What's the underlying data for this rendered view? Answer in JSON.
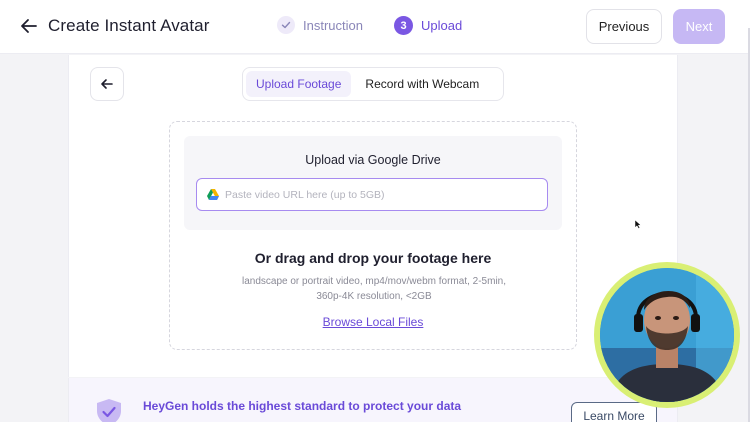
{
  "header": {
    "title": "Create Instant Avatar",
    "steps": [
      {
        "label": "Instruction",
        "state": "done"
      },
      {
        "number": "3",
        "label": "Upload",
        "state": "active"
      }
    ],
    "previous_label": "Previous",
    "next_label": "Next"
  },
  "tabs": [
    {
      "label": "Upload Footage",
      "active": true
    },
    {
      "label": "Record with Webcam",
      "active": false
    }
  ],
  "upload": {
    "drive_title": "Upload via Google Drive",
    "url_placeholder": "Paste video URL here (up to 5GB)",
    "drag_title": "Or drag and drop your footage here",
    "drag_desc_line1": "landscape or portrait video, mp4/mov/webm format, 2-5min,",
    "drag_desc_line2": "360p-4K resolution, <2GB",
    "browse_label": "Browse Local Files"
  },
  "banner": {
    "text": "HeyGen holds the highest standard to protect your data",
    "learn_more_label": "Learn More"
  },
  "colors": {
    "accent": "#7a57e3",
    "accent_text": "#6a4ad8",
    "next_disabled": "#c6b8f4",
    "webcam_ring": "#d9ef74"
  },
  "icons": [
    "back-arrow-icon",
    "check-icon",
    "google-drive-icon",
    "shield-check-icon",
    "cursor-icon"
  ]
}
